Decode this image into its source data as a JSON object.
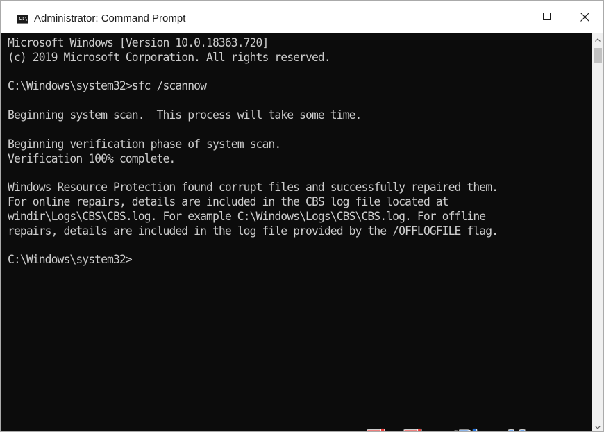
{
  "window": {
    "title": "Administrator: Command Prompt",
    "icon": "cmd-icon",
    "icon_text": "C:\\",
    "controls": [
      "minimize-icon",
      "maximize-icon",
      "close-icon"
    ]
  },
  "console": {
    "lines": [
      "Microsoft Windows [Version 10.0.18363.720]",
      "(c) 2019 Microsoft Corporation. All rights reserved.",
      "",
      "C:\\Windows\\system32>sfc /scannow",
      "",
      "Beginning system scan.  This process will take some time.",
      "",
      "Beginning verification phase of system scan.",
      "Verification 100% complete.",
      "",
      "Windows Resource Protection found corrupt files and successfully repaired them.",
      "For online repairs, details are included in the CBS log file located at",
      "windir\\Logs\\CBS\\CBS.log. For example C:\\Windows\\Logs\\CBS\\CBS.log. For offline",
      "repairs, details are included in the log file provided by the /OFFLOGFILE flag.",
      "",
      "C:\\Windows\\system32>"
    ]
  },
  "watermark": {
    "part1": "ThuThuat",
    "part2": "PhanMem",
    "part3": ".vn"
  },
  "colors": {
    "console_bg": "#0c0c0c",
    "console_text": "#cccccc",
    "titlebar_bg": "#ffffff",
    "watermark_red": "#e53935",
    "watermark_blue": "#1e6fd9"
  }
}
